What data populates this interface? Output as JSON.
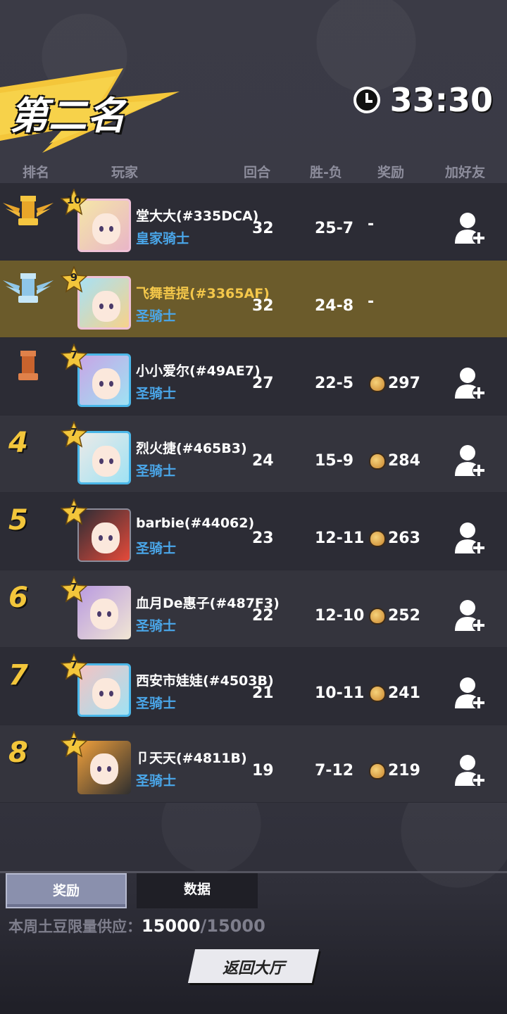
{
  "header": {
    "rank_title": "第二名",
    "timer": "33:30"
  },
  "columns": {
    "rank": "排名",
    "player": "玩家",
    "rounds": "回合",
    "win_loss": "胜-负",
    "reward": "奖励",
    "add_friend": "加好友"
  },
  "players": [
    {
      "rank": "1",
      "rank_icon": "gold-rook-icon",
      "level": "10",
      "name": "堂大大(#335DCA)",
      "title": "皇家骑士",
      "rounds": "32",
      "win_loss": "25-7",
      "reward": "-",
      "add_friend": true
    },
    {
      "rank": "2",
      "rank_icon": "silver-rook-icon",
      "level": "9",
      "name": "飞舞菩提(#3365AF)",
      "title": "圣骑士",
      "rounds": "32",
      "win_loss": "24-8",
      "reward": "-",
      "add_friend": false,
      "is_me": true
    },
    {
      "rank": "3",
      "rank_icon": "bronze-rook-icon",
      "level": "7",
      "name": "小小爱尔(#49AE7)",
      "title": "圣骑士",
      "rounds": "27",
      "win_loss": "22-5",
      "reward": "297",
      "add_friend": true
    },
    {
      "rank": "4",
      "level": "7",
      "name": "烈火捷(#465B3)",
      "title": "圣骑士",
      "rounds": "24",
      "win_loss": "15-9",
      "reward": "284",
      "add_friend": true
    },
    {
      "rank": "5",
      "level": "7",
      "name": "barbie(#44062)",
      "title": "圣骑士",
      "rounds": "23",
      "win_loss": "12-11",
      "reward": "263",
      "add_friend": true
    },
    {
      "rank": "6",
      "level": "7",
      "name": "血月De惠子(#487F3)",
      "title": "圣骑士",
      "rounds": "22",
      "win_loss": "12-10",
      "reward": "252",
      "add_friend": true
    },
    {
      "rank": "7",
      "level": "7",
      "name": "西安市娃娃(#4503B)",
      "title": "圣骑士",
      "rounds": "21",
      "win_loss": "10-11",
      "reward": "241",
      "add_friend": true
    },
    {
      "rank": "8",
      "level": "7",
      "name": "卩天天(#4811B)",
      "title": "圣骑士",
      "rounds": "19",
      "win_loss": "7-12",
      "reward": "219",
      "add_friend": true
    }
  ],
  "tabs": {
    "reward": "奖励",
    "data": "数据"
  },
  "supply": {
    "label": "本周土豆限量供应：",
    "current": "15000",
    "total": "/15000"
  },
  "back_button": "返回大厅",
  "colors": {
    "gold": "#f3c63b",
    "title_blue": "#4aa7ea",
    "highlight_row": "#6b5b2b"
  }
}
